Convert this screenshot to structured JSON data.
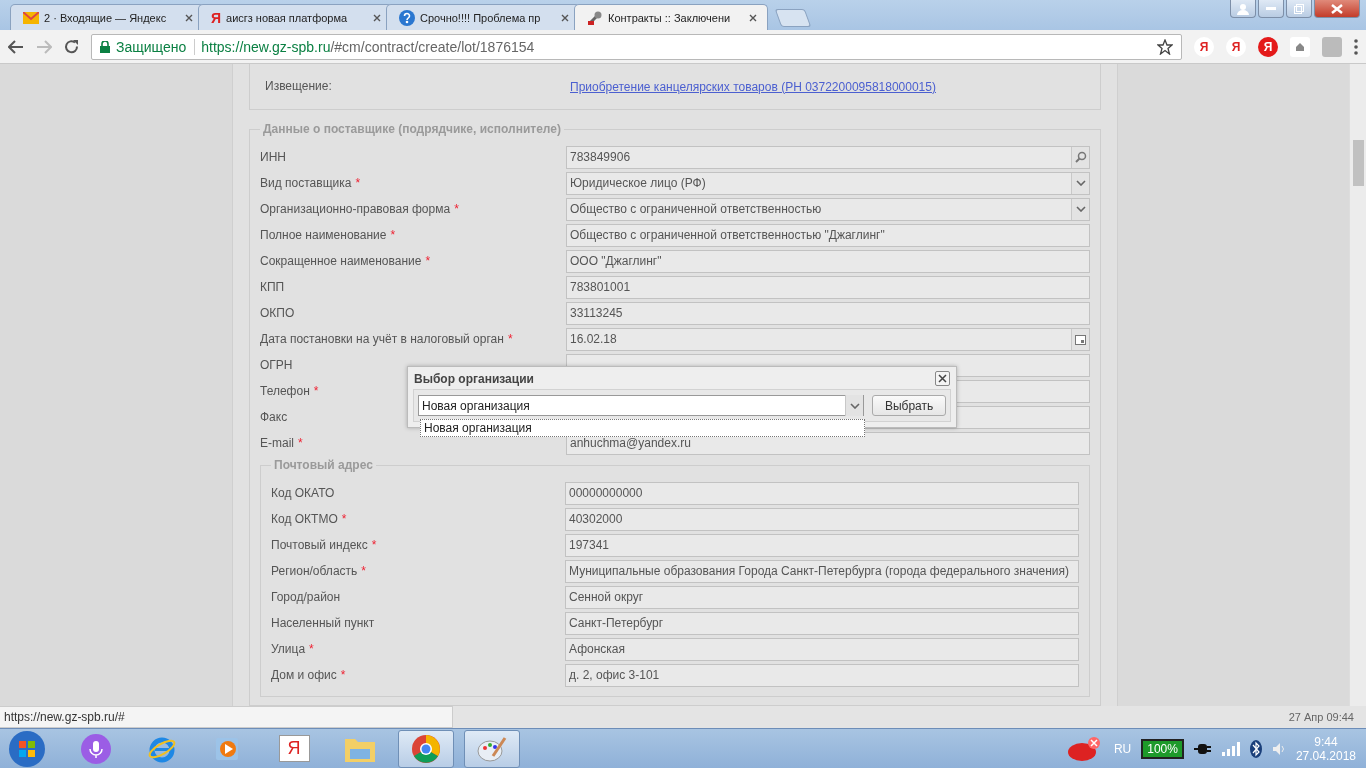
{
  "browser": {
    "tabs": [
      {
        "kind": "mail",
        "label": "2 · Входящие — Яндекс",
        "selected": false
      },
      {
        "kind": "yandex",
        "icon_text": "Я",
        "label": "аисгз новая платформа",
        "selected": false
      },
      {
        "kind": "question",
        "label": "Срочно!!!! Проблема пр",
        "selected": false
      },
      {
        "kind": "tools",
        "label": "Контракты :: Заключени",
        "selected": true
      }
    ],
    "secure_label": "Защищено",
    "url_host": "https://new.gz-spb.ru",
    "url_path": "/#cm/contract/create/lot/1876154",
    "extensions": [
      {
        "kind": "plain",
        "text": "Я"
      },
      {
        "kind": "plain",
        "text": "Я"
      },
      {
        "kind": "filled",
        "text": "Я"
      },
      {
        "kind": "home"
      },
      {
        "kind": "grey"
      }
    ]
  },
  "notice": {
    "label": "Извещение:",
    "link": "Приобретение канцелярских товаров (РН 0372200095818000015)"
  },
  "supplier": {
    "legend": "Данные о поставщике (подрядчике, исполнителе)",
    "fields": [
      {
        "label": "ИНН",
        "kind": "search",
        "value": "783849906"
      },
      {
        "label": "Вид поставщика",
        "required_mark": "*",
        "kind": "select",
        "value": "Юридическое лицо (РФ)"
      },
      {
        "label": "Организационно-правовая форма",
        "required_mark": "*",
        "kind": "select",
        "value": "Общество с ограниченной ответственностью"
      },
      {
        "label": "Полное наименование",
        "required_mark": "*",
        "kind": "text",
        "value": "Общество с ограниченной ответственностью \"Джаглинг\""
      },
      {
        "label": "Сокращенное наименование",
        "required_mark": "*",
        "kind": "text",
        "value": "ООО \"Джаглинг\""
      },
      {
        "label": "КПП",
        "kind": "text",
        "value": "783801001"
      },
      {
        "label": "ОКПО",
        "kind": "text",
        "value": "33113245"
      },
      {
        "label": "Дата постановки на учёт в налоговый орган",
        "required_mark": "*",
        "kind": "date",
        "value": "16.02.18"
      },
      {
        "label": "ОГРН",
        "kind": "text"
      },
      {
        "label": "Телефон",
        "required_mark": "*",
        "kind": "text"
      },
      {
        "label": "Факс",
        "kind": "text"
      },
      {
        "label": "E-mail",
        "required_mark": "*",
        "kind": "text",
        "value": "anhuchma@yandex.ru"
      }
    ],
    "postal": {
      "legend": "Почтовый адрес",
      "fields": [
        {
          "label": "Код ОКАТО",
          "value": "00000000000"
        },
        {
          "label": "Код ОКТМО",
          "required_mark": "*",
          "value": "40302000"
        },
        {
          "label": "Почтовый индекс",
          "required_mark": "*",
          "value": "197341"
        },
        {
          "label": "Регион/область",
          "required_mark": "*",
          "value": "Муниципальные образования Города Санкт-Петербурга (города федерального значения)"
        },
        {
          "label": "Город/район",
          "value": "Сенной округ"
        },
        {
          "label": "Населенный пункт",
          "value": "Санкт-Петербург"
        },
        {
          "label": "Улица",
          "required_mark": "*",
          "value": "Афонская"
        },
        {
          "label": "Дом и офис",
          "required_mark": "*",
          "value": "д. 2, офис 3-101"
        }
      ]
    }
  },
  "dialog": {
    "title": "Выбор организации",
    "combo_value": "Новая организация",
    "options": [
      "Новая организация"
    ],
    "button": "Выбрать"
  },
  "page_footer": {
    "timestamp": "27 Апр 09:44"
  },
  "status_url": "https://new.gz-spb.ru/#",
  "taskbar": {
    "apps": [
      {
        "kind": "mic",
        "active": false
      },
      {
        "kind": "ie",
        "active": false
      },
      {
        "kind": "media",
        "active": false
      },
      {
        "kind": "yandex",
        "text": "Я",
        "active": false
      },
      {
        "kind": "folder",
        "active": false
      },
      {
        "kind": "chrome",
        "active": true
      },
      {
        "kind": "paint",
        "active": true
      }
    ],
    "language": "RU",
    "battery": "100%",
    "time": "9:44",
    "date": "27.04.2018"
  }
}
